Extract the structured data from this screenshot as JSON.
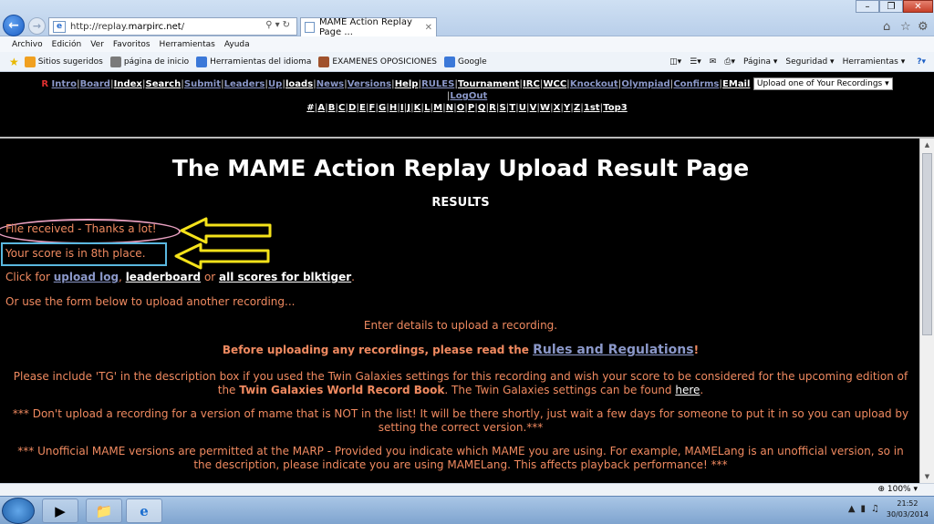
{
  "browser": {
    "url_prefix": "http://replay.",
    "url_host": "marpirc.net",
    "url_suffix": "/",
    "tab_title": "MAME Action Replay Page ...",
    "menu": [
      "Archivo",
      "Edición",
      "Ver",
      "Favoritos",
      "Herramientas",
      "Ayuda"
    ],
    "favorites": [
      {
        "label": "Sitios sugeridos",
        "color": "#f0a020"
      },
      {
        "label": "página de inicio",
        "color": "#7a7a7a"
      },
      {
        "label": "Herramientas del idioma",
        "color": "#3b78d8"
      },
      {
        "label": "EXAMENES OPOSICIONES",
        "color": "#a0522d"
      },
      {
        "label": "Google",
        "color": "#3b78d8"
      }
    ],
    "commands": [
      "Página ▾",
      "Seguridad ▾",
      "Herramientas ▾"
    ],
    "zoom": "100%"
  },
  "nav": {
    "row1_prefix": "R",
    "row1": [
      {
        "label": "Intro",
        "white": false
      },
      {
        "label": "Board",
        "white": false
      },
      {
        "label": "Index",
        "white": true
      },
      {
        "label": "Search",
        "white": true
      },
      {
        "label": "Submit",
        "white": false
      },
      {
        "label": "Leaders",
        "white": false
      },
      {
        "label": "Up",
        "white": false
      },
      {
        "label": "loads",
        "white": true
      },
      {
        "label": "News",
        "white": false
      },
      {
        "label": "Versions",
        "white": false
      },
      {
        "label": "Help",
        "white": true
      },
      {
        "label": "RULES",
        "white": false
      },
      {
        "label": "Tournament",
        "white": true
      },
      {
        "label": "IRC",
        "white": true
      },
      {
        "label": "WCC",
        "white": true
      },
      {
        "label": "Knockout",
        "white": false
      },
      {
        "label": "Olympiad",
        "white": false
      },
      {
        "label": "Confirms",
        "white": false
      },
      {
        "label": "EMail",
        "white": true
      }
    ],
    "select_label": "Upload one of Your Recordings",
    "logout": "LogOut",
    "letters": [
      "#",
      "A",
      "B",
      "C",
      "D",
      "E",
      "F",
      "G",
      "H",
      "I",
      "J",
      "K",
      "L",
      "M",
      "N",
      "O",
      "P",
      "Q",
      "R",
      "S",
      "T",
      "U",
      "V",
      "W",
      "X",
      "Y",
      "Z",
      "1st",
      "Top3"
    ]
  },
  "page": {
    "title": "The MAME Action Replay Upload Result Page",
    "results": "RESULTS",
    "received": "File received - Thanks a lot!",
    "score": "Your score is in 8th place.",
    "click_for": "Click for ",
    "upload_log": "upload log",
    "comma": ", ",
    "leaderboard": "leaderboard",
    "or": " or ",
    "all_scores": "all scores for blktiger",
    "dot": ".",
    "use_form": "Or use the form below to upload another recording...",
    "enter_details": "Enter details to upload a recording.",
    "before": "Before uploading any recordings, please read the ",
    "rules": "Rules and Regulations",
    "excl": "!",
    "tg_line1": "Please include 'TG' in the description box if you used the Twin Galaxies settings for this recording and wish your score to be considered for the upcoming edition of",
    "tg_the": "the ",
    "tg_book": "Twin Galaxies World Record Book",
    "tg_mid": ". The Twin Galaxies settings can be found ",
    "tg_here": "here",
    "tg_end": ".",
    "warn1_a": "*** Don't upload a recording for a version of mame that is NOT in the list! It will be there shortly, just wait a few days for someone to put it in so you can upload by",
    "warn1_b": "setting the correct version.***",
    "warn2_a": "*** Unofficial MAME versions are permitted at the MARP - Provided you indicate which MAME you are using. For example, MAMELang is an unofficial version, so in",
    "warn2_b": "the description, please indicate you are using MAMELang. This affects playback performance! ***"
  },
  "taskbar": {
    "time": "21:52",
    "date": "30/03/2014"
  }
}
